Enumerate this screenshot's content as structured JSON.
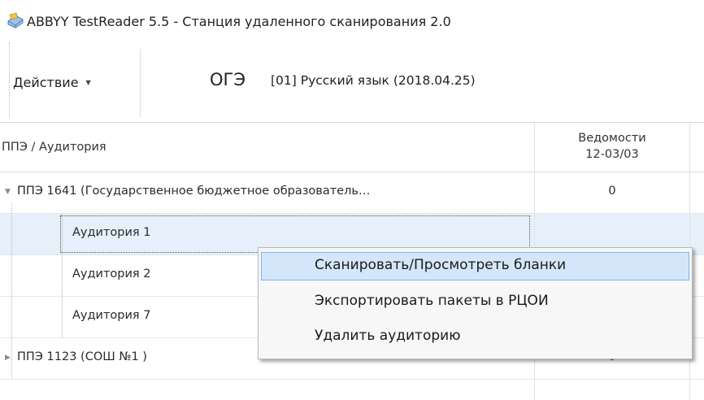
{
  "window": {
    "title": "ABBYY TestReader 5.5 - Станция удаленного сканирования 2.0",
    "icon": "scanner-app-icon"
  },
  "toolbar": {
    "action_label": "Действие",
    "action_caret": "▼",
    "exam_type": "ОГЭ",
    "exam_subject": "[01] Русский язык (2018.04.25)"
  },
  "grid": {
    "columns": [
      {
        "label": "ППЭ / Аудитория"
      },
      {
        "label": "Ведомости",
        "label2": "12-03/03"
      }
    ],
    "rows": [
      {
        "name": "ППЭ 1641 (Государственное бюджетное образователь…",
        "value": "0",
        "expander": "▼",
        "expanded": true,
        "level": 0
      },
      {
        "name": "Аудитория 1",
        "value": "",
        "level": 1,
        "selected": true
      },
      {
        "name": "Аудитория 2",
        "value": "",
        "level": 1
      },
      {
        "name": "Аудитория 7",
        "value": "",
        "level": 1
      },
      {
        "name": "ППЭ 1123 (СОШ №1 )",
        "value": "0",
        "expander": "▶",
        "expanded": false,
        "level": 0
      }
    ]
  },
  "context_menu": {
    "items": [
      {
        "label": "Сканировать/Просмотреть бланки",
        "highlighted": true
      },
      {
        "label": "Экспортировать пакеты в РЦОИ",
        "highlighted": false
      },
      {
        "label": "Удалить аудиторию",
        "highlighted": false
      }
    ]
  }
}
